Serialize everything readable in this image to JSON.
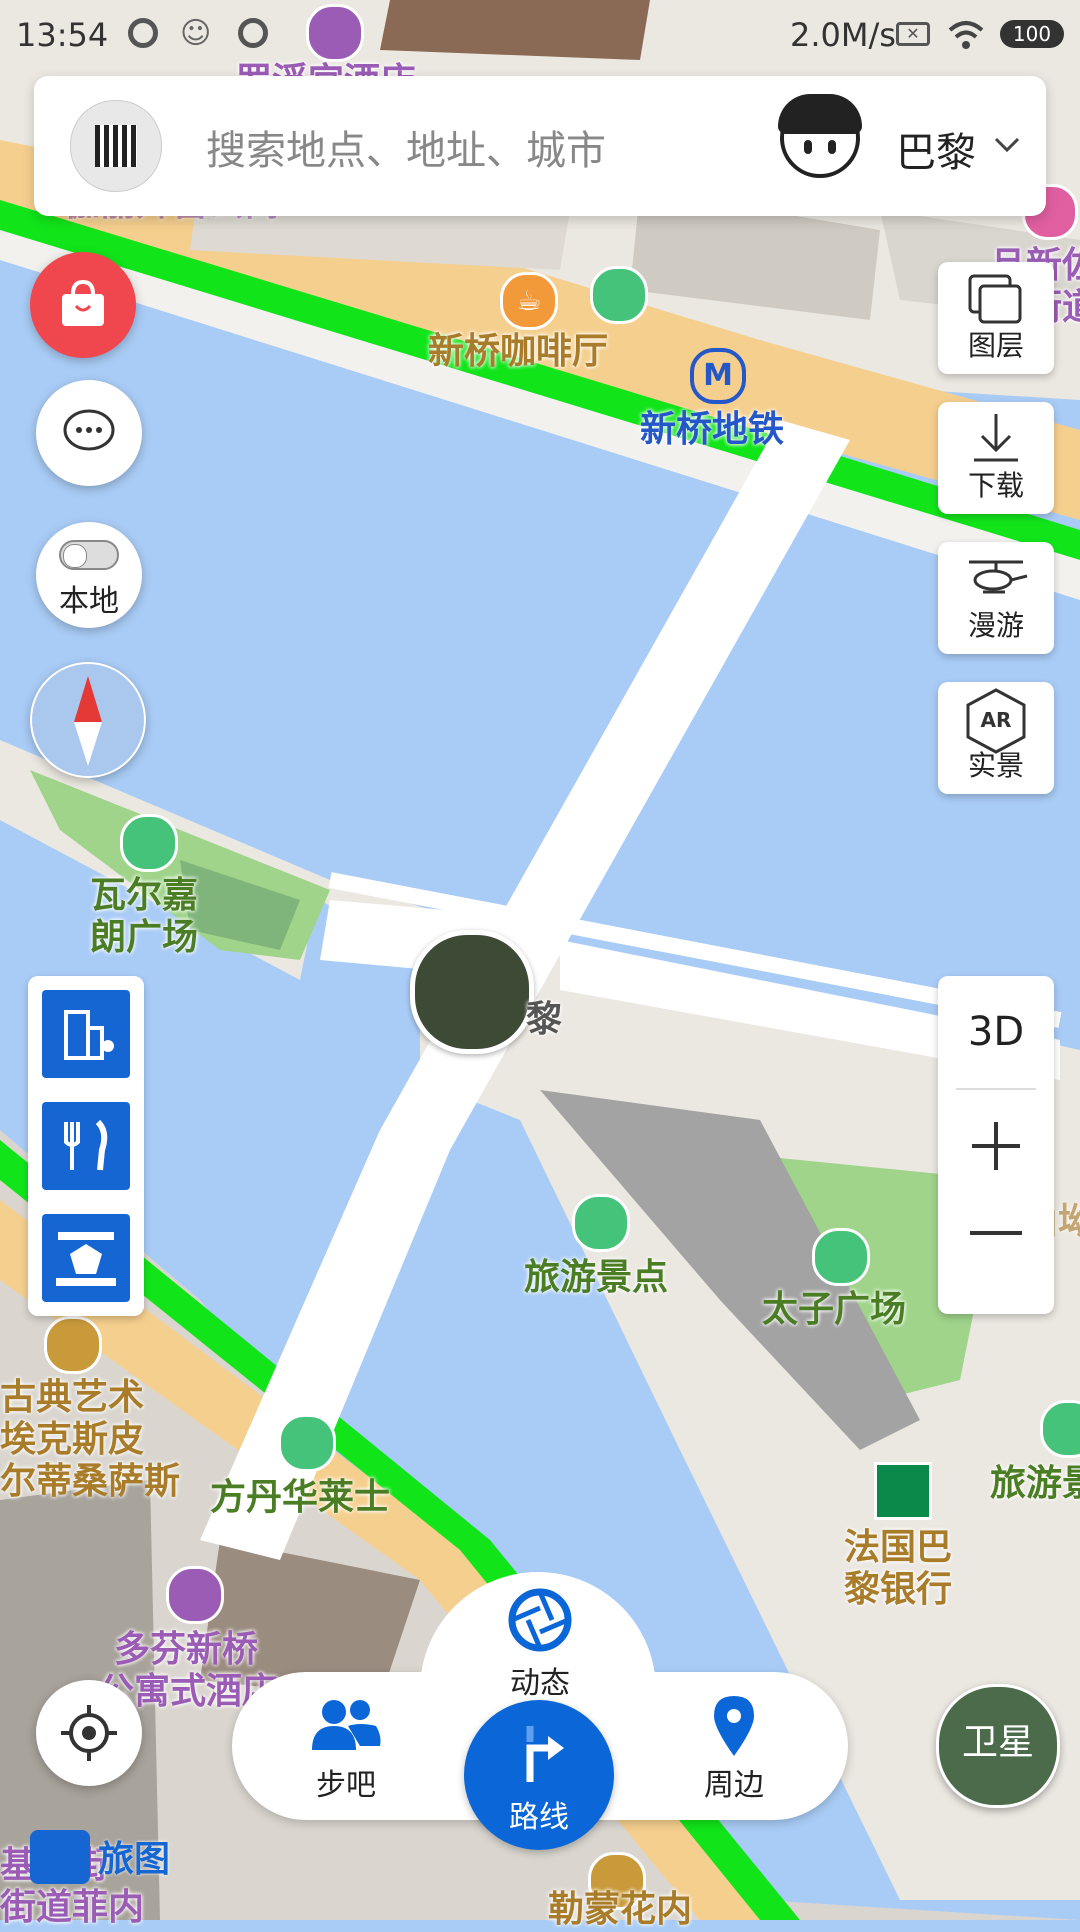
{
  "status_bar": {
    "time": "13:54",
    "network_speed": "2.0M/s",
    "battery": "100"
  },
  "search": {
    "placeholder": "搜索地点、地址、城市",
    "city": "巴黎"
  },
  "right_controls": {
    "layers": "图层",
    "download": "下载",
    "roam": "漫游",
    "ar_badge": "AR",
    "ar": "实景",
    "mode_3d": "3D"
  },
  "left_controls": {
    "local_label": "本地"
  },
  "map_labels": {
    "hotel_top": "罗浮宫酒店",
    "apartment": "伽丽卉窖公寓",
    "street_right": "旦新佐",
    "street_right2": "猫街道路",
    "cafe": "新桥咖啡厅",
    "metro_sign": "M",
    "metro": "新桥地铁",
    "square1_line1": "瓦尔嘉",
    "square1_line2": "朗广场",
    "photo_marker_suffix": "黎",
    "scenic": "旅游景点",
    "square2": "太子广场",
    "right_edge_label": "巨合山坳",
    "museum_line1": "古典艺术",
    "museum_line2": "埃克斯皮",
    "museum_line3": "尔蒂桑萨斯",
    "fontaine": "方丹华莱士",
    "bank_line1": "法国巴",
    "bank_line2": "黎银行",
    "scenic_right": "旅游景",
    "hotel2_line1": "多芬新桥",
    "hotel2_line2": "公寓式酒店",
    "bottom_left1": "基治街",
    "bottom_left2": "街道菲内",
    "bottom_center": "勒蒙花内"
  },
  "bottom_nav": {
    "dynamic": "动态",
    "walk": "步吧",
    "route": "路线",
    "nearby": "周边",
    "satellite": "卫星"
  },
  "brand": {
    "name": "旅图"
  },
  "colors": {
    "water": "#a9ccf6",
    "road_orange": "#f5cf8e",
    "park_green": "#00e000",
    "accent_blue": "#0b67d8",
    "poi_green": "#4a7d24",
    "red_btn": "#f0474f"
  }
}
